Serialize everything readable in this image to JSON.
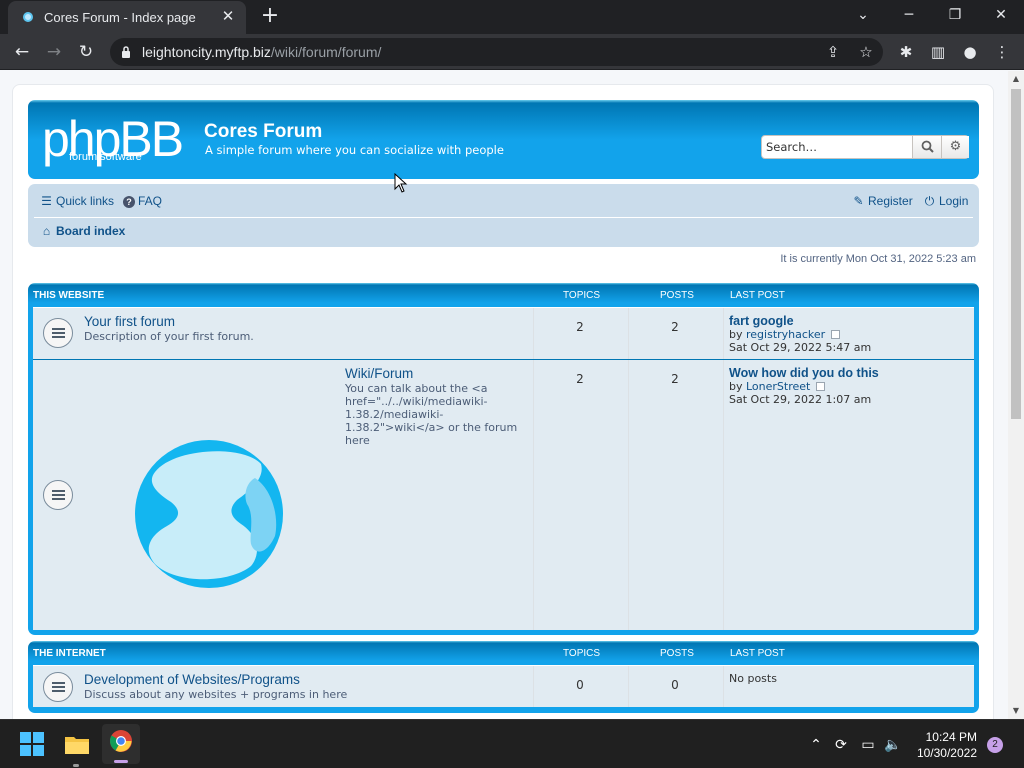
{
  "browser": {
    "tab_title": "Cores Forum - Index page",
    "url_host": "leightoncity.myftp.biz",
    "url_path": "/wiki/forum/forum/"
  },
  "header": {
    "logo_text": "phpBB",
    "logo_sub": "forum software",
    "site_title": "Cores Forum",
    "site_desc": "A simple forum where you can socialize with people",
    "search_placeholder": "Search…"
  },
  "navbar": {
    "quick_links": "Quick links",
    "faq": "FAQ",
    "register": "Register",
    "login": "Login",
    "board_index": "Board index"
  },
  "current_time": "It is currently Mon Oct 31, 2022 5:23 am",
  "column_headers": {
    "topics": "Topics",
    "posts": "Posts",
    "last_post": "Last post"
  },
  "categories": [
    {
      "name": "This website",
      "forums": [
        {
          "title": "Your first forum",
          "desc": "Description of your first forum.",
          "topics": "2",
          "posts": "2",
          "last_post_title": "fart google",
          "last_post_by_label": "by",
          "last_post_user": "registryhacker",
          "last_post_date": "Sat Oct 29, 2022 5:47 am"
        },
        {
          "title": "Wiki/Forum",
          "desc": "You can talk about the <a href=\"../../wiki/mediawiki-1.38.2/mediawiki-1.38.2\">wiki</a> or the forum here",
          "topics": "2",
          "posts": "2",
          "last_post_title": "Wow how did you do this",
          "last_post_by_label": "by",
          "last_post_user": "LonerStreet",
          "last_post_date": "Sat Oct 29, 2022 1:07 am"
        }
      ]
    },
    {
      "name": "The internet",
      "forums": [
        {
          "title": "Development of Websites/Programs",
          "desc": "Discuss about any websites + programs in here",
          "topics": "0",
          "posts": "0",
          "last_post_none": "No posts"
        }
      ]
    }
  ],
  "taskbar": {
    "time": "10:24 PM",
    "date": "10/30/2022",
    "notifications": "2"
  },
  "colors": {
    "accent": "#12a3eb",
    "link": "#105289",
    "row_bg": "#e1ebf2"
  }
}
